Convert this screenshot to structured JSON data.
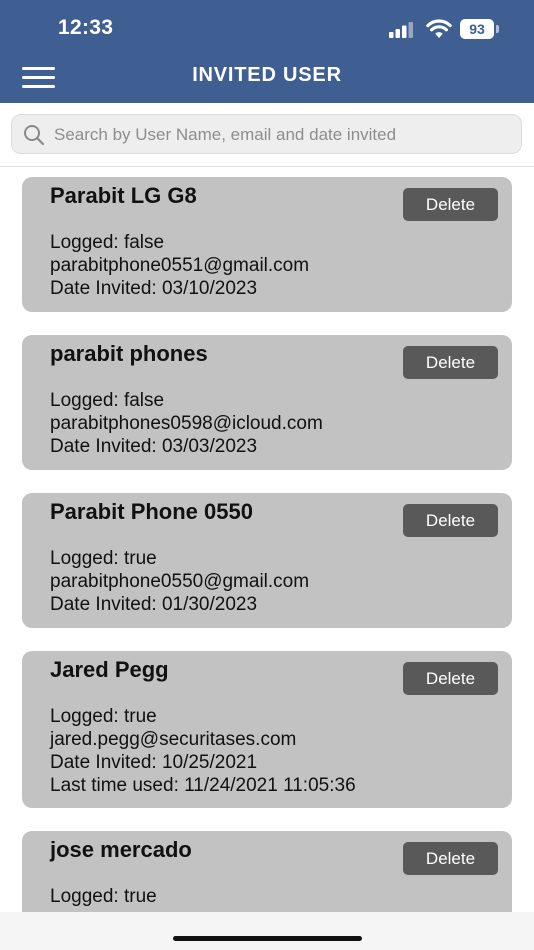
{
  "status": {
    "time": "12:33",
    "battery": "93"
  },
  "header": {
    "title": "INVITED USER"
  },
  "search": {
    "placeholder": "Search by User Name, email and date invited"
  },
  "users": [
    {
      "name": "Parabit LG G8",
      "logged": "Logged: false",
      "email": "parabitphone0551@gmail.com",
      "invited": "Date Invited: 03/10/2023",
      "delete_label": "Delete"
    },
    {
      "name": "parabit phones",
      "logged": "Logged: false",
      "email": "parabitphones0598@icloud.com",
      "invited": "Date Invited: 03/03/2023",
      "delete_label": "Delete"
    },
    {
      "name": "Parabit Phone 0550",
      "logged": "Logged: true",
      "email": "parabitphone0550@gmail.com",
      "invited": "Date Invited: 01/30/2023",
      "delete_label": "Delete"
    },
    {
      "name": "Jared Pegg",
      "logged": "Logged: true",
      "email": "jared.pegg@securitases.com",
      "invited": "Date Invited: 10/25/2021",
      "last_used": "Last time used: 11/24/2021 11:05:36",
      "delete_label": "Delete"
    },
    {
      "name": "jose mercado",
      "logged": "Logged: true",
      "delete_label": "Delete"
    }
  ]
}
